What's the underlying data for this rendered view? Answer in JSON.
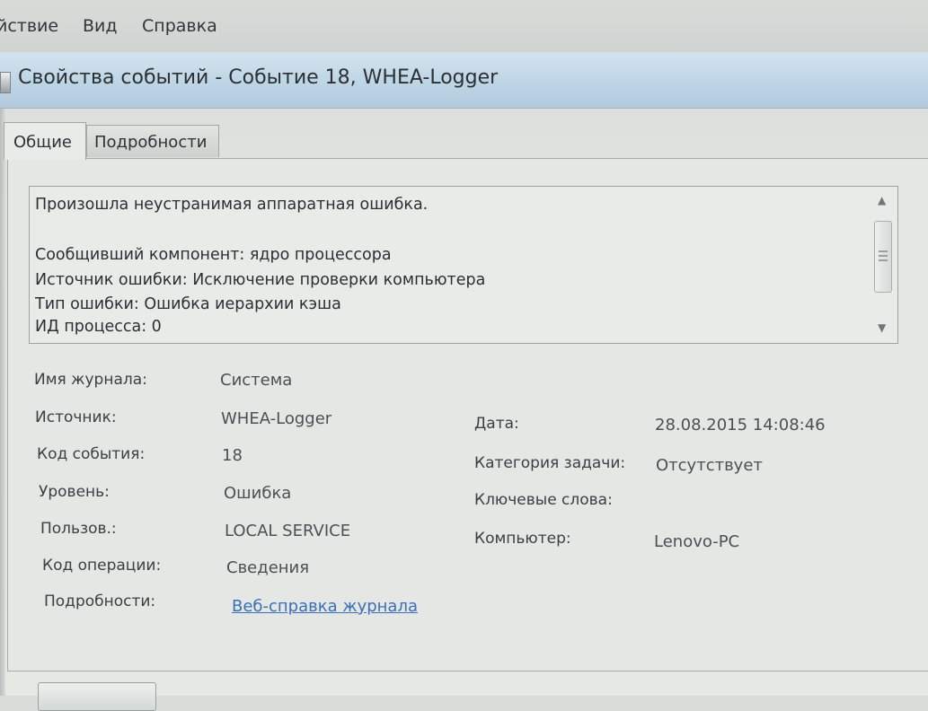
{
  "menu": {
    "items": [
      "йствие",
      "Вид",
      "Справка"
    ]
  },
  "window": {
    "title": "Свойства событий - Событие 18, WHEA-Logger"
  },
  "tabs": [
    {
      "label": "Общие",
      "active": true
    },
    {
      "label": "Подробности",
      "active": false
    }
  ],
  "description": {
    "lines": [
      "Произошла неустранимая аппаратная ошибка.",
      "",
      "Сообщивший компонент: ядро процессора",
      "Источник ошибки: Исключение проверки компьютера",
      "Тип ошибки: Ошибка иерархии кэша",
      "ИД процесса: 0"
    ]
  },
  "fields": {
    "log_name_label": "Имя журнала:",
    "log_name_value": "Система",
    "source_label": "Источник:",
    "source_value": "WHEA-Logger",
    "event_id_label": "Код события:",
    "event_id_value": "18",
    "level_label": "Уровень:",
    "level_value": "Ошибка",
    "user_label": "Пользов.:",
    "user_value": "LOCAL SERVICE",
    "opcode_label": "Код операции:",
    "opcode_value": "Сведения",
    "details_label": "Подробности:",
    "details_link": "Веб-справка журнала",
    "date_label": "Дата:",
    "date_value": "28.08.2015 14:08:46",
    "task_category_label": "Категория задачи:",
    "task_category_value": "Отсутствует",
    "keywords_label": "Ключевые слова:",
    "keywords_value": "",
    "computer_label": "Компьютер:",
    "computer_value": "Lenovo-PC"
  },
  "colors": {
    "titlebar": "#bcd4e4",
    "link": "#3a6fb8"
  }
}
